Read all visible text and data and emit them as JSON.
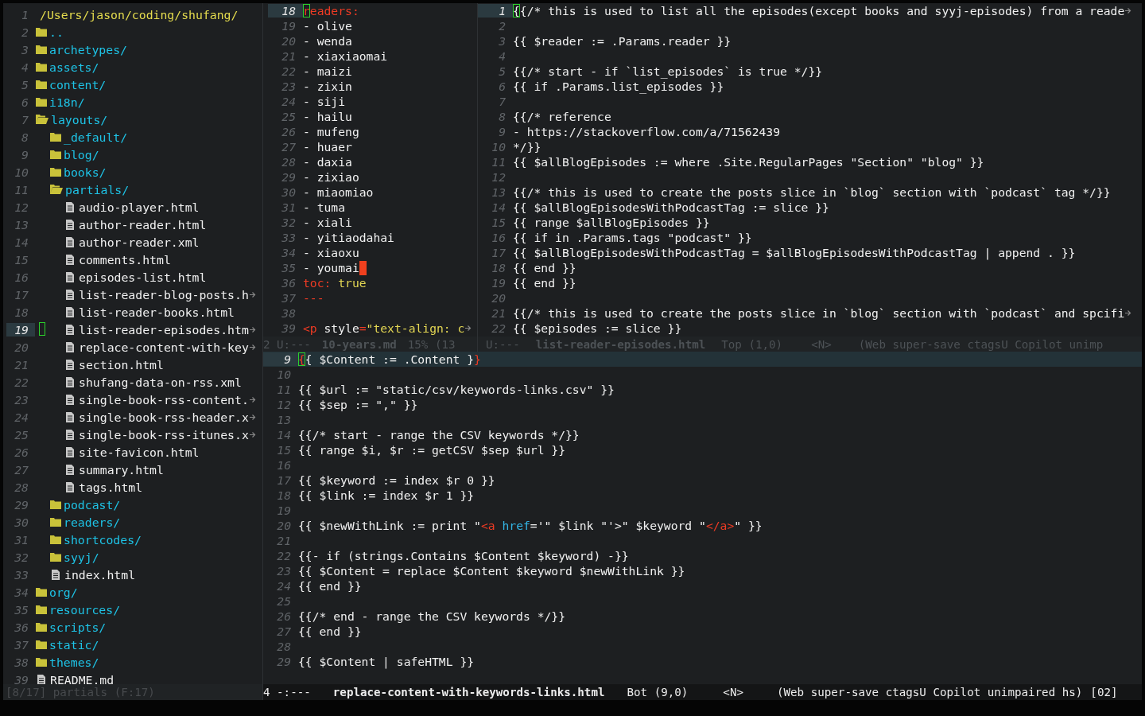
{
  "tree": {
    "items": [
      {
        "n": "1",
        "kind": "path",
        "name": "/Users/jason/coding/shufang/",
        "selected": false
      },
      {
        "n": "2",
        "kind": "folder",
        "name": "..",
        "selected": false
      },
      {
        "n": "3",
        "kind": "folder",
        "name": "archetypes/",
        "selected": false
      },
      {
        "n": "4",
        "kind": "folder",
        "name": "assets/",
        "selected": false
      },
      {
        "n": "5",
        "kind": "folder",
        "name": "content/",
        "selected": false
      },
      {
        "n": "6",
        "kind": "folder",
        "name": "i18n/",
        "selected": false
      },
      {
        "n": "7",
        "kind": "folder",
        "name": "layouts/",
        "expanded": true,
        "selected": false,
        "children": [
          {
            "n": "8",
            "kind": "folder",
            "name": "_default/",
            "selected": false
          },
          {
            "n": "9",
            "kind": "folder",
            "name": "blog/",
            "selected": false
          },
          {
            "n": "10",
            "kind": "folder",
            "name": "books/",
            "selected": false
          },
          {
            "n": "11",
            "kind": "folder",
            "name": "partials/",
            "expanded": true,
            "selected": false,
            "children": [
              {
                "n": "12",
                "kind": "file",
                "name": "audio-player.html",
                "selected": false
              },
              {
                "n": "13",
                "kind": "file",
                "name": "author-reader.html",
                "selected": false
              },
              {
                "n": "14",
                "kind": "file",
                "name": "author-reader.xml",
                "selected": false
              },
              {
                "n": "15",
                "kind": "file",
                "name": "comments.html",
                "selected": false
              },
              {
                "n": "16",
                "kind": "file",
                "name": "episodes-list.html",
                "selected": false
              },
              {
                "n": "17",
                "kind": "file",
                "name": "list-reader-blog-posts.h",
                "truncated": true,
                "selected": false
              },
              {
                "n": "18",
                "kind": "file",
                "name": "list-reader-books.html",
                "selected": false
              },
              {
                "n": "19",
                "kind": "file",
                "name": "list-reader-episodes.htm",
                "truncated": true,
                "selected": true,
                "cursor": true
              },
              {
                "n": "20",
                "kind": "file",
                "name": "replace-content-with-key",
                "truncated": true,
                "selected": false
              },
              {
                "n": "21",
                "kind": "file",
                "name": "section.html",
                "selected": false
              },
              {
                "n": "22",
                "kind": "file",
                "name": "shufang-data-on-rss.xml",
                "selected": false
              },
              {
                "n": "23",
                "kind": "file",
                "name": "single-book-rss-content.",
                "truncated": true,
                "selected": false
              },
              {
                "n": "24",
                "kind": "file",
                "name": "single-book-rss-header.x",
                "truncated": true,
                "selected": false
              },
              {
                "n": "25",
                "kind": "file",
                "name": "single-book-rss-itunes.x",
                "truncated": true,
                "selected": false
              },
              {
                "n": "26",
                "kind": "file",
                "name": "site-favicon.html",
                "selected": false
              },
              {
                "n": "27",
                "kind": "file",
                "name": "summary.html",
                "selected": false
              },
              {
                "n": "28",
                "kind": "file",
                "name": "tags.html",
                "selected": false
              }
            ]
          },
          {
            "n": "29",
            "kind": "folder",
            "name": "podcast/",
            "selected": false
          },
          {
            "n": "30",
            "kind": "folder",
            "name": "readers/",
            "selected": false
          },
          {
            "n": "31",
            "kind": "folder",
            "name": "shortcodes/",
            "selected": false
          },
          {
            "n": "32",
            "kind": "folder",
            "name": "syyj/",
            "selected": false
          },
          {
            "n": "33",
            "kind": "file",
            "name": "index.html",
            "selected": false
          }
        ]
      },
      {
        "n": "34",
        "kind": "folder",
        "name": "org/",
        "selected": false
      },
      {
        "n": "35",
        "kind": "folder",
        "name": "resources/",
        "selected": false
      },
      {
        "n": "36",
        "kind": "folder",
        "name": "scripts/",
        "selected": false
      },
      {
        "n": "37",
        "kind": "folder",
        "name": "static/",
        "selected": false
      },
      {
        "n": "38",
        "kind": "folder",
        "name": "themes/",
        "selected": false
      },
      {
        "n": "39",
        "kind": "file",
        "name": "README.md",
        "selected": false
      }
    ],
    "mode_line": {
      "active": false,
      "segments": [
        {
          "t": "[8/17] partials (F:17)",
          "kind": "info"
        }
      ]
    }
  },
  "panes": [
    {
      "active": false,
      "lines": [
        {
          "n": "18",
          "current": true,
          "tokens": [
            {
              "t": "r",
              "kind": "key",
              "cursor": true
            },
            {
              "t": "eaders:",
              "kind": "key"
            }
          ]
        },
        {
          "n": "19",
          "current": false,
          "text": "- olive"
        },
        {
          "n": "20",
          "current": false,
          "text": "- wenda"
        },
        {
          "n": "21",
          "current": false,
          "text": "- xiaxiaomai"
        },
        {
          "n": "22",
          "current": false,
          "text": "- maizi"
        },
        {
          "n": "23",
          "current": false,
          "text": "- zixin"
        },
        {
          "n": "24",
          "current": false,
          "text": "- siji"
        },
        {
          "n": "25",
          "current": false,
          "text": "- hailu"
        },
        {
          "n": "26",
          "current": false,
          "text": "- mufeng"
        },
        {
          "n": "27",
          "current": false,
          "text": "- huaer"
        },
        {
          "n": "28",
          "current": false,
          "text": "- daxia"
        },
        {
          "n": "29",
          "current": false,
          "text": "- zixiao"
        },
        {
          "n": "30",
          "current": false,
          "text": "- miaomiao"
        },
        {
          "n": "31",
          "current": false,
          "text": "- tuma"
        },
        {
          "n": "32",
          "current": false,
          "text": "- xiali"
        },
        {
          "n": "33",
          "current": false,
          "text": "- yitiaodahai"
        },
        {
          "n": "34",
          "current": false,
          "text": "- xiaoxu"
        },
        {
          "n": "35",
          "current": false,
          "text": "- youmai",
          "block_cursor": true
        },
        {
          "n": "36",
          "current": false,
          "tokens": [
            {
              "t": "toc:",
              "kind": "key"
            },
            {
              "t": " true",
              "kind": "value"
            }
          ]
        },
        {
          "n": "37",
          "current": false,
          "tokens": [
            {
              "t": "---",
              "kind": "key"
            }
          ]
        },
        {
          "n": "38",
          "current": false
        },
        {
          "n": "39",
          "current": false,
          "truncated": true,
          "tokens": [
            {
              "t": "<p",
              "kind": "tag"
            },
            {
              "t": " style",
              "kind": "plain"
            },
            {
              "t": "=",
              "kind": "tag"
            },
            {
              "t": "\"text-align: c",
              "kind": "value"
            }
          ]
        }
      ],
      "mode_line": {
        "active": false,
        "segments": [
          {
            "t": "2 U:---",
            "kind": "state"
          },
          {
            "t": "10-years.md",
            "kind": "name"
          },
          {
            "t": "15% (13",
            "kind": "pos"
          }
        ]
      }
    },
    {
      "active": false,
      "lines": [
        {
          "n": "1",
          "current": true,
          "truncated": true,
          "tokens": [
            {
              "t": "{",
              "kind": "plain",
              "cursor": true
            },
            {
              "t": "{/* this is used to list all the episodes(except books and syyj-episodes) from a reade",
              "kind": "plain"
            }
          ]
        },
        {
          "n": "2",
          "current": false
        },
        {
          "n": "3",
          "current": false,
          "text": "{{ $reader := .Params.reader }}"
        },
        {
          "n": "4",
          "current": false
        },
        {
          "n": "5",
          "current": false,
          "text": "{{/* start - if `list_episodes` is true */}}"
        },
        {
          "n": "6",
          "current": false,
          "text": "{{ if .Params.list_episodes }}"
        },
        {
          "n": "7",
          "current": false
        },
        {
          "n": "8",
          "current": false,
          "text": "{{/* reference"
        },
        {
          "n": "9",
          "current": false,
          "text": "- https://stackoverflow.com/a/71562439"
        },
        {
          "n": "10",
          "current": false,
          "text": "*/}}"
        },
        {
          "n": "11",
          "current": false,
          "text": "{{ $allBlogEpisodes := where .Site.RegularPages \"Section\" \"blog\" }}"
        },
        {
          "n": "12",
          "current": false
        },
        {
          "n": "13",
          "current": false,
          "text": "{{/* this is used to create the posts slice in `blog` section with `podcast` tag */}}"
        },
        {
          "n": "14",
          "current": false,
          "text": "{{ $allBlogEpisodesWithPodcastTag := slice }}"
        },
        {
          "n": "15",
          "current": false,
          "text": "{{ range $allBlogEpisodes }}"
        },
        {
          "n": "16",
          "current": false,
          "text": "{{ if in .Params.tags \"podcast\" }}"
        },
        {
          "n": "17",
          "current": false,
          "text": "{{ $allBlogEpisodesWithPodcastTag = $allBlogEpisodesWithPodcastTag | append . }}"
        },
        {
          "n": "18",
          "current": false,
          "text": "{{ end }}"
        },
        {
          "n": "19",
          "current": false,
          "text": "{{ end }}"
        },
        {
          "n": "20",
          "current": false
        },
        {
          "n": "21",
          "current": false,
          "truncated": true,
          "text": "{{/* this is used to create the posts slice in `blog` section with `podcast` and spcifi"
        },
        {
          "n": "22",
          "current": false,
          "text": "{{ $episodes := slice }}"
        }
      ],
      "mode_line": {
        "active": false,
        "segments": [
          {
            "t": "U:---",
            "kind": "state"
          },
          {
            "t": "list-reader-episodes.html",
            "kind": "name"
          },
          {
            "t": "Top (1,0)",
            "kind": "pos"
          },
          {
            "t": "<N>",
            "kind": "evil"
          },
          {
            "t": "(Web super-save ctagsU Copilot unimp",
            "kind": "modes"
          }
        ]
      }
    },
    {
      "active": true,
      "lines": [
        {
          "n": "9",
          "current": true,
          "tokens": [
            {
              "t": "{",
              "kind": "tag",
              "cursor": true
            },
            {
              "t": "{ $Content := .Content }",
              "kind": "plain"
            },
            {
              "t": "}",
              "kind": "tag"
            }
          ]
        },
        {
          "n": "10",
          "current": false
        },
        {
          "n": "11",
          "current": false,
          "text": "{{ $url := \"static/csv/keywords-links.csv\" }}"
        },
        {
          "n": "12",
          "current": false,
          "text": "{{ $sep := \",\" }}"
        },
        {
          "n": "13",
          "current": false
        },
        {
          "n": "14",
          "current": false,
          "text": "{{/* start - range the CSV keywords */}}"
        },
        {
          "n": "15",
          "current": false,
          "text": "{{ range $i, $r := getCSV $sep $url }}"
        },
        {
          "n": "16",
          "current": false
        },
        {
          "n": "17",
          "current": false,
          "text": "{{ $keyword := index $r 0 }}"
        },
        {
          "n": "18",
          "current": false,
          "text": "{{ $link := index $r 1 }}"
        },
        {
          "n": "19",
          "current": false
        },
        {
          "n": "20",
          "current": false,
          "tokens": [
            {
              "t": "{{ $newWithLink := print \"",
              "kind": "plain"
            },
            {
              "t": "<a",
              "kind": "tag"
            },
            {
              "t": " href",
              "kind": "attr"
            },
            {
              "t": "='\" $link \"'>\" $keyword \"",
              "kind": "plain"
            },
            {
              "t": "</a>",
              "kind": "tag"
            },
            {
              "t": "\" }}",
              "kind": "plain"
            }
          ]
        },
        {
          "n": "21",
          "current": false
        },
        {
          "n": "22",
          "current": false,
          "text": "{{- if (strings.Contains $Content $keyword) -}}"
        },
        {
          "n": "23",
          "current": false,
          "text": "{{ $Content = replace $Content $keyword $newWithLink }}"
        },
        {
          "n": "24",
          "current": false,
          "text": "{{ end }}"
        },
        {
          "n": "25",
          "current": false
        },
        {
          "n": "26",
          "current": false,
          "text": "{{/* end - range the CSV keywords */}}"
        },
        {
          "n": "27",
          "current": false,
          "text": "{{ end }}"
        },
        {
          "n": "28",
          "current": false
        },
        {
          "n": "29",
          "current": false,
          "text": "{{ $Content | safeHTML }}"
        }
      ],
      "mode_line": {
        "active": true,
        "segments": [
          {
            "t": "4 -:---",
            "kind": "state"
          },
          {
            "t": "replace-content-with-keywords-links.html",
            "kind": "name"
          },
          {
            "t": "Bot (9,0)",
            "kind": "pos"
          },
          {
            "t": "<N>",
            "kind": "evil"
          },
          {
            "t": "(Web super-save ctagsU Copilot unimpaired hs)",
            "kind": "modes"
          },
          {
            "t": "[02]",
            "kind": "num"
          }
        ]
      }
    }
  ]
}
